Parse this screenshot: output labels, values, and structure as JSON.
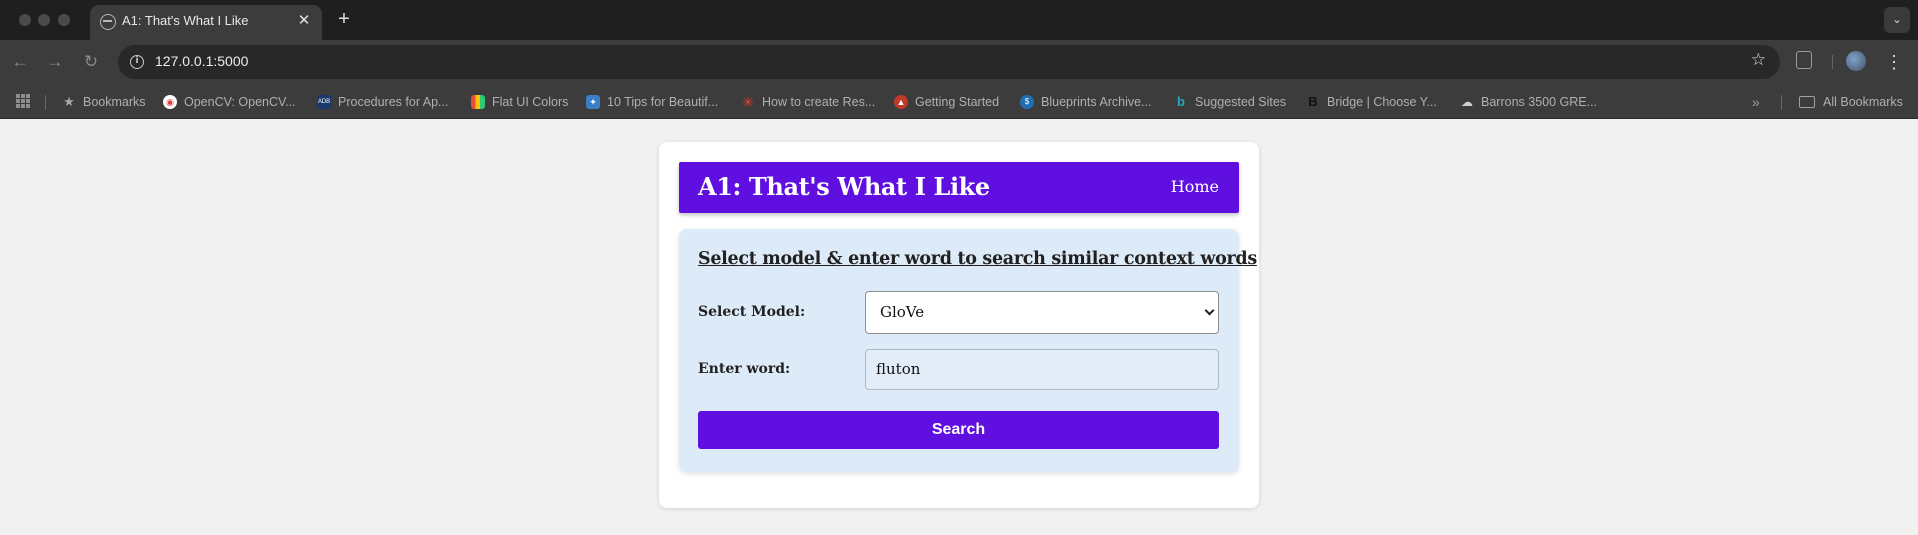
{
  "browser": {
    "tab": {
      "title": "A1: That's What I Like"
    },
    "address_bar": {
      "url": "127.0.0.1:5000"
    },
    "bookmarks": [
      {
        "label": "Bookmarks",
        "icon": "star-icon"
      },
      {
        "label": "OpenCV: OpenCV...",
        "icon": "opencv-icon"
      },
      {
        "label": "Procedures for Ap...",
        "icon": "adb-icon"
      },
      {
        "label": "Flat UI Colors",
        "icon": "flat-ui-icon"
      },
      {
        "label": "10 Tips for Beautif...",
        "icon": "tips-icon"
      },
      {
        "label": "How to create Res...",
        "icon": "asterisk-icon"
      },
      {
        "label": "Getting Started",
        "icon": "getting-started-icon"
      },
      {
        "label": "Blueprints Archive...",
        "icon": "blueprints-icon"
      },
      {
        "label": "Suggested Sites",
        "icon": "bing-icon"
      },
      {
        "label": "Bridge | Choose Y...",
        "icon": "bridge-icon"
      },
      {
        "label": "Barrons 3500 GRE...",
        "icon": "cloud-icon"
      }
    ],
    "all_bookmarks": "All Bookmarks"
  },
  "page": {
    "title": "A1: That's What I Like",
    "nav_home": "Home",
    "form": {
      "heading": "Select model & enter word to search similar context words",
      "model_label": "Select Model:",
      "model_value": "GloVe",
      "word_label": "Enter word:",
      "word_value": "fluton",
      "search_button": "Search"
    }
  },
  "colors": {
    "accent": "#5f0fe0",
    "panel_background": "#dcebf7",
    "page_background": "#f1f1f1"
  }
}
